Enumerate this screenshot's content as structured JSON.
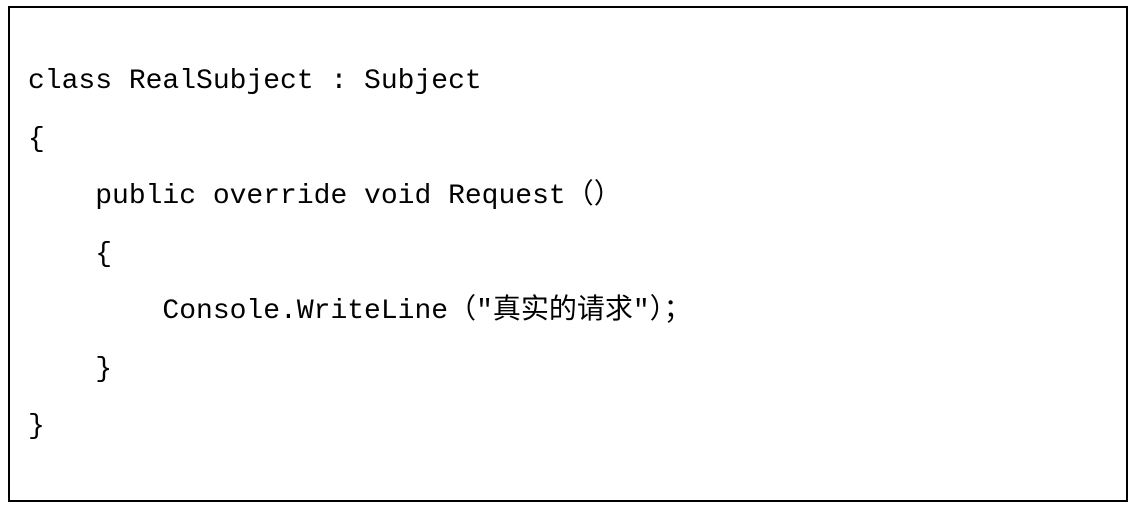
{
  "code": {
    "lines": [
      "class RealSubject : Subject",
      "{",
      "    public override void Request（）",
      "    {",
      "        Console.WriteLine（\"真实的请求\"）；",
      "    }",
      "}"
    ]
  }
}
